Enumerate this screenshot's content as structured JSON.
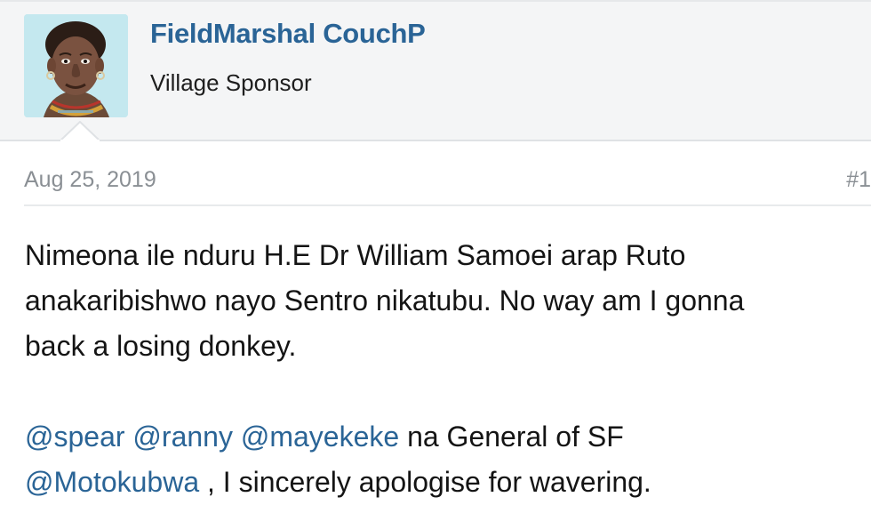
{
  "user": {
    "name": "FieldMarshal CouchP",
    "title": "Village Sponsor"
  },
  "post": {
    "date": "Aug 25, 2019",
    "number": "#1",
    "paragraph1": {
      "line1": "Nimeona ile nduru H.E Dr William Samoei arap Ruto",
      "line2": "anakaribishwo nayo Sentro nikatubu. No way am I gonna",
      "line3": "back a losing donkey."
    },
    "paragraph2": {
      "mention1": "@spear",
      "mention2": "@ranny",
      "mention3": "@mayekeke",
      "text1": "na General of SF",
      "mention4": "@Motokubwa",
      "text2": ", I sincerely apologise for wavering."
    }
  },
  "colors": {
    "link": "#2a6496",
    "header_bg": "#f4f5f6",
    "meta_text": "#8a8f94"
  },
  "icons": {
    "avatar": "portrait-avatar"
  }
}
